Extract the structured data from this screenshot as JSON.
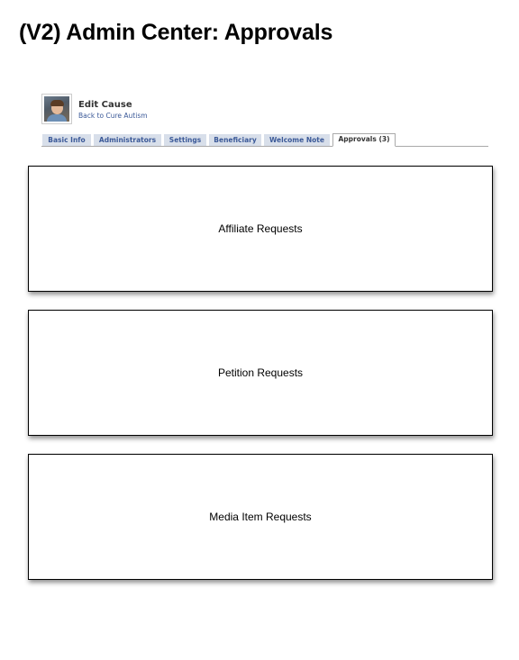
{
  "page": {
    "title": "(V2) Admin Center: Approvals"
  },
  "header": {
    "edit_title": "Edit Cause",
    "back_link": "Back to Cure Autism"
  },
  "tabs": [
    {
      "label": "Basic Info",
      "active": false
    },
    {
      "label": "Administrators",
      "active": false
    },
    {
      "label": "Settings",
      "active": false
    },
    {
      "label": "Beneficiary",
      "active": false
    },
    {
      "label": "Welcome Note",
      "active": false
    },
    {
      "label": "Approvals (3)",
      "active": true
    }
  ],
  "panels": [
    {
      "label": "Affiliate Requests"
    },
    {
      "label": "Petition Requests"
    },
    {
      "label": "Media Item Requests"
    }
  ],
  "colors": {
    "link_blue": "#3b5998",
    "tab_background": "#d8dfea"
  }
}
